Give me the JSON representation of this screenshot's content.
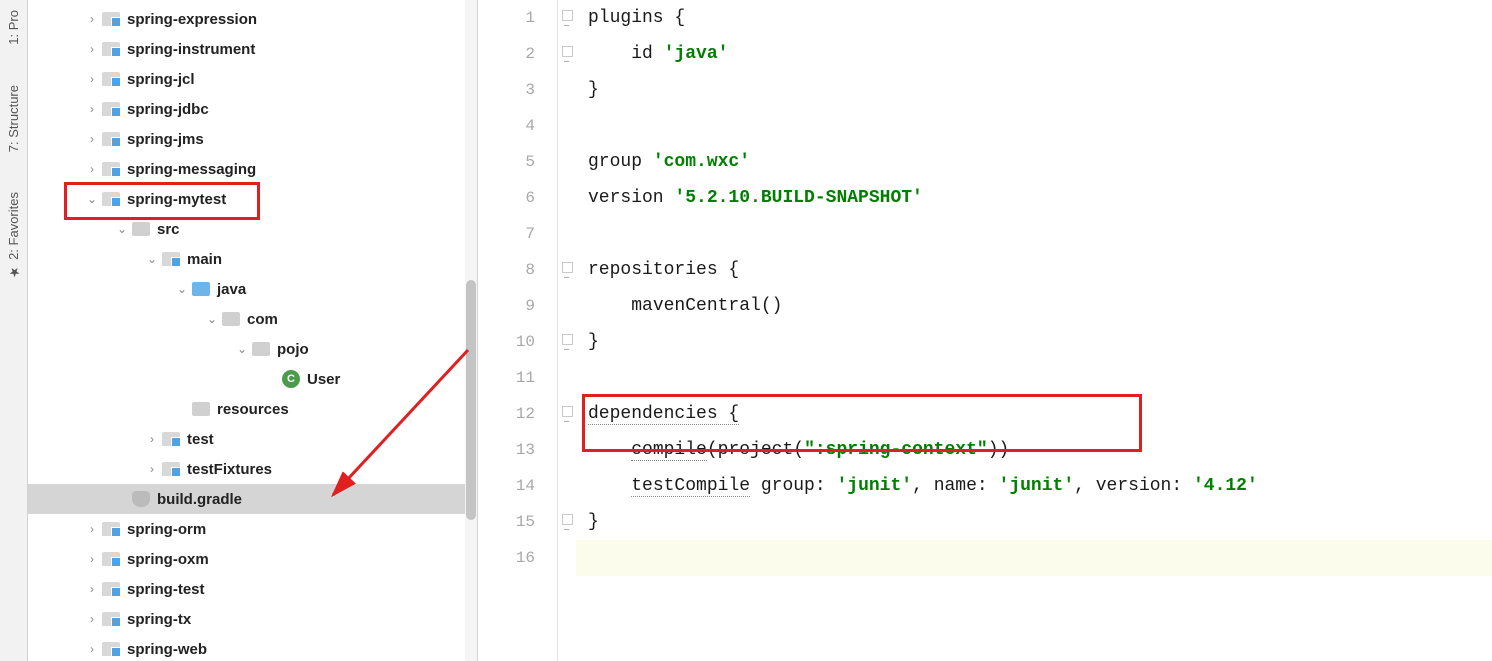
{
  "sideTabs": {
    "project": "1: Pro",
    "structure": "7: Structure",
    "favorites": "2: Favorites"
  },
  "tree": {
    "items": [
      {
        "indent": 0,
        "chev": ">",
        "icon": "module",
        "label": "spring-expression"
      },
      {
        "indent": 0,
        "chev": ">",
        "icon": "module",
        "label": "spring-instrument"
      },
      {
        "indent": 0,
        "chev": ">",
        "icon": "module",
        "label": "spring-jcl"
      },
      {
        "indent": 0,
        "chev": ">",
        "icon": "module",
        "label": "spring-jdbc"
      },
      {
        "indent": 0,
        "chev": ">",
        "icon": "module",
        "label": "spring-jms"
      },
      {
        "indent": 0,
        "chev": ">",
        "icon": "module",
        "label": "spring-messaging"
      },
      {
        "indent": 0,
        "chev": "v",
        "icon": "module",
        "label": "spring-mytest"
      },
      {
        "indent": 1,
        "chev": "v",
        "icon": "folder-grey",
        "label": "src"
      },
      {
        "indent": 2,
        "chev": "v",
        "icon": "module",
        "label": "main"
      },
      {
        "indent": 3,
        "chev": "v",
        "icon": "folder-plain",
        "label": "java"
      },
      {
        "indent": 4,
        "chev": "v",
        "icon": "folder-grey",
        "label": "com"
      },
      {
        "indent": 5,
        "chev": "v",
        "icon": "folder-grey",
        "label": "pojo"
      },
      {
        "indent": 6,
        "chev": "",
        "icon": "class",
        "label": "User"
      },
      {
        "indent": 3,
        "chev": "",
        "icon": "folder-grey",
        "label": "resources"
      },
      {
        "indent": 2,
        "chev": ">",
        "icon": "module",
        "label": "test"
      },
      {
        "indent": 2,
        "chev": ">",
        "icon": "module",
        "label": "testFixtures"
      },
      {
        "indent": 1,
        "chev": "",
        "icon": "gradle",
        "label": "build.gradle",
        "selected": true
      },
      {
        "indent": 0,
        "chev": ">",
        "icon": "module",
        "label": "spring-orm"
      },
      {
        "indent": 0,
        "chev": ">",
        "icon": "module",
        "label": "spring-oxm"
      },
      {
        "indent": 0,
        "chev": ">",
        "icon": "module",
        "label": "spring-test"
      },
      {
        "indent": 0,
        "chev": ">",
        "icon": "module",
        "label": "spring-tx"
      },
      {
        "indent": 0,
        "chev": ">",
        "icon": "module",
        "label": "spring-web"
      }
    ]
  },
  "gutter": [
    1,
    2,
    3,
    4,
    5,
    6,
    7,
    8,
    9,
    10,
    11,
    12,
    13,
    14,
    15,
    16
  ],
  "foldMarks": {
    "1": "open",
    "2": "close",
    "8": "open",
    "10": "close",
    "12": "open",
    "15": "close"
  },
  "code": {
    "l1_a": "plugins {",
    "l2_indent": "    ",
    "l2_a": "id ",
    "l2_str": "'java'",
    "l3": "}",
    "l4": "",
    "l5_a": "group ",
    "l5_str": "'com.wxc'",
    "l6_a": "version ",
    "l6_str": "'5.2.10.BUILD-SNAPSHOT'",
    "l7": "",
    "l8_a": "repositories {",
    "l9_indent": "    ",
    "l9_a": "mavenCentral()",
    "l10": "}",
    "l11": "",
    "l12_a": "dependencies {",
    "l13_indent": "    ",
    "l13_a": "compile",
    "l13_b": "(project(",
    "l13_str": "\":spring-context\"",
    "l13_c": "))",
    "l14_indent": "    ",
    "l14_a": "testCompile",
    "l14_b": " group: ",
    "l14_s1": "'junit'",
    "l14_c": ", name: ",
    "l14_s2": "'junit'",
    "l14_d": ", version: ",
    "l14_s3": "'4.12'",
    "l15": "}",
    "l16": ""
  }
}
